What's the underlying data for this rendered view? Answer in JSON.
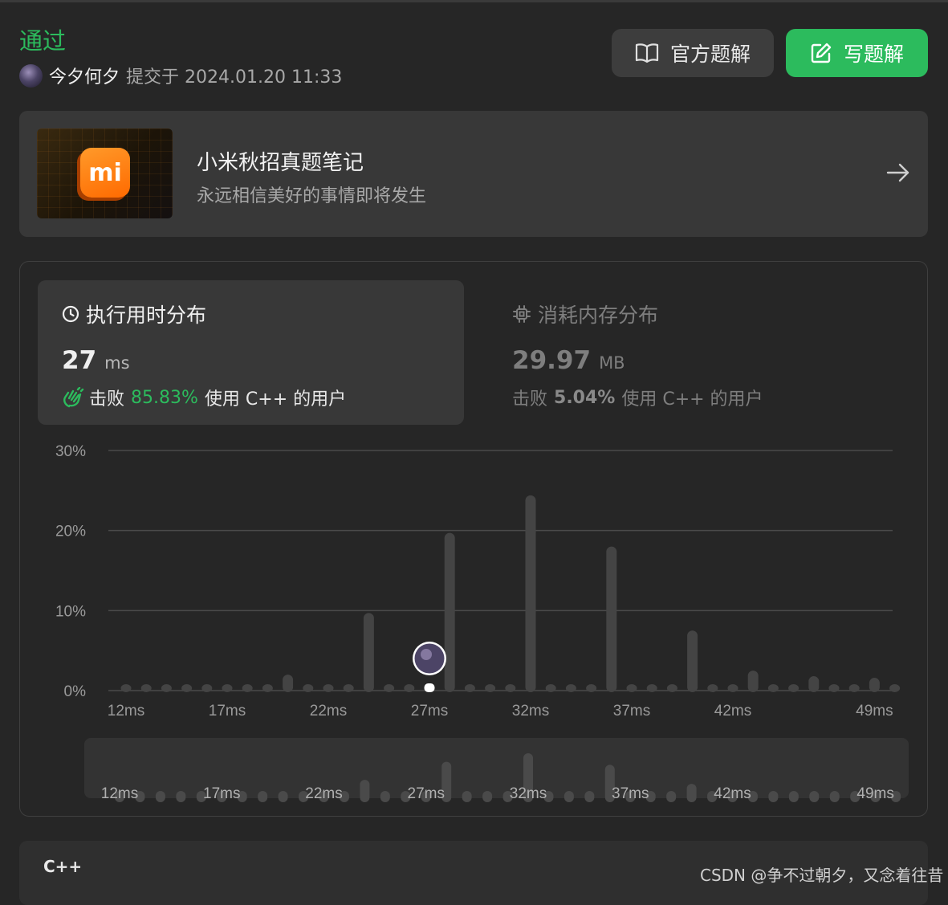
{
  "header": {
    "status": "通过",
    "username": "今夕何夕",
    "submitted_text": "提交于 2024.01.20 11:33",
    "official_solution_label": "官方题解",
    "write_solution_label": "写题解",
    "accent_color": "#2cbb5d"
  },
  "banner": {
    "title": "小米秋招真题笔记",
    "subtitle": "永远相信美好的事情即将发生",
    "logo_text": "mi"
  },
  "runtime": {
    "title": "执行用时分布",
    "value": "27",
    "unit": "ms",
    "beat_label": "击败",
    "beat_pct": "85.83%",
    "beat_suffix": "使用 C++ 的用户",
    "icon": "clock-icon"
  },
  "memory": {
    "title": "消耗内存分布",
    "value": "29.97",
    "unit": "MB",
    "beat_label": "击败",
    "beat_pct": "5.04%",
    "beat_suffix": "使用 C++ 的用户",
    "icon": "chip-icon"
  },
  "chart_data": {
    "type": "bar",
    "x_start_ms": 12,
    "x": [
      12,
      13,
      14,
      15,
      16,
      17,
      18,
      19,
      20,
      21,
      22,
      23,
      24,
      25,
      26,
      27,
      28,
      29,
      30,
      31,
      32,
      33,
      34,
      35,
      36,
      37,
      38,
      39,
      40,
      41,
      42,
      43,
      44,
      45,
      46,
      47,
      48,
      49,
      50
    ],
    "values": [
      0.4,
      0.4,
      0.4,
      0.4,
      0.4,
      0.4,
      0.4,
      0.4,
      2.0,
      0.4,
      0.4,
      0.4,
      9.7,
      0.4,
      0.4,
      0.4,
      19.7,
      0.4,
      0.4,
      0.4,
      24.4,
      0.4,
      0.4,
      0.4,
      18.0,
      0.4,
      0.4,
      0.4,
      7.5,
      0.4,
      0.4,
      2.5,
      0.4,
      0.4,
      1.8,
      0.4,
      0.4,
      1.6,
      0.4
    ],
    "user_x": 27,
    "yticks": [
      "0%",
      "10%",
      "20%",
      "30%"
    ],
    "ylim": [
      0,
      30
    ],
    "xtick_labels": [
      "12ms",
      "17ms",
      "22ms",
      "27ms",
      "32ms",
      "37ms",
      "42ms",
      "49ms"
    ],
    "xtick_positions": [
      12,
      17,
      22,
      27,
      32,
      37,
      42,
      49
    ],
    "grid": true
  },
  "code": {
    "language": "C++"
  },
  "watermark": "CSDN @争不过朝夕，又念着往昔"
}
